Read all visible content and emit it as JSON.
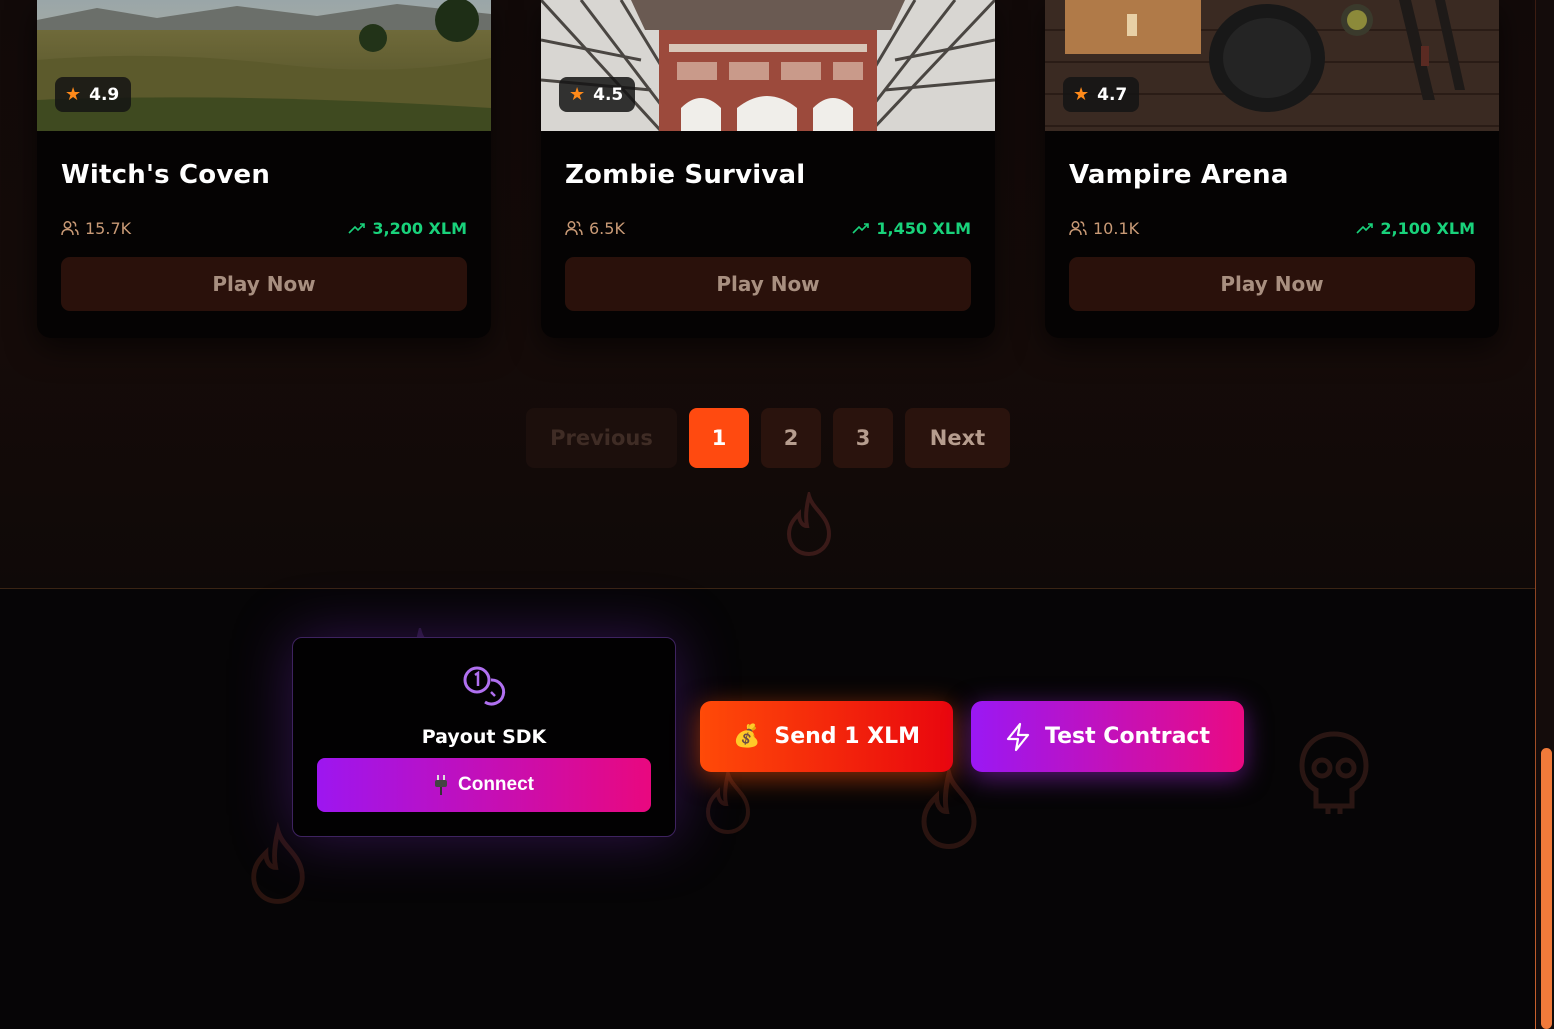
{
  "games": [
    {
      "title": "Witch's Coven",
      "rating": "4.9",
      "players": "15.7K",
      "earnings": "3,200 XLM",
      "play_label": "Play Now"
    },
    {
      "title": "Zombie Survival",
      "rating": "4.5",
      "players": "6.5K",
      "earnings": "1,450 XLM",
      "play_label": "Play Now"
    },
    {
      "title": "Vampire Arena",
      "rating": "4.7",
      "players": "10.1K",
      "earnings": "2,100 XLM",
      "play_label": "Play Now"
    }
  ],
  "pagination": {
    "previous": "Previous",
    "pages": [
      "1",
      "2",
      "3"
    ],
    "current": "1",
    "next": "Next"
  },
  "payout": {
    "title": "Payout SDK",
    "connect_label": "Connect",
    "connect_icon": "plug-icon"
  },
  "actions": {
    "send_label": "Send 1 XLM",
    "send_icon": "money-bag-icon",
    "test_label": "Test Contract",
    "test_icon": "lightning-icon"
  },
  "colors": {
    "accent": "#ff4a10",
    "earnings": "#19d27b",
    "star": "#ff8a1a",
    "purple": "#9d16f0",
    "pink": "#e9087f"
  }
}
